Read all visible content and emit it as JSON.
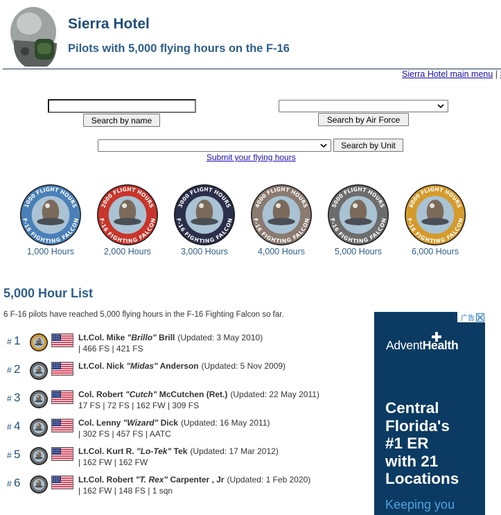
{
  "header": {
    "title": "Sierra Hotel",
    "subtitle": "Pilots with 5,000 flying hours on the F-16",
    "nav_link": "Sierra Hotel main menu",
    "nav_sep": " | ",
    "nav_next": "S"
  },
  "search": {
    "name_value": "",
    "name_button": "Search by name",
    "airforce_selected": "",
    "airforce_button": "Search by Air Force",
    "unit_selected": "",
    "unit_button": "Search by Unit",
    "submit_link": "Submit your flying hours"
  },
  "badges": [
    {
      "label": "1,000 Hours",
      "ring_text": "1000 FLIGHT HOURS",
      "ring_color": "#4a80b8"
    },
    {
      "label": "2,000 Hours",
      "ring_text": "2000 FLIGHT HOURS",
      "ring_color": "#c8352b"
    },
    {
      "label": "3,000 Hours",
      "ring_text": "3000 FLIGHT HOURS",
      "ring_color": "#2b2f4a"
    },
    {
      "label": "4,000 Hours",
      "ring_text": "4000 FLIGHT HOURS",
      "ring_color": "#8a7a70"
    },
    {
      "label": "5,000 Hours",
      "ring_text": "5000 FLIGHT HOURS",
      "ring_color": "#6c6c6c"
    },
    {
      "label": "6,000 Hours",
      "ring_text": "6000 FLIGHT HOURS",
      "ring_color": "#d59a2c"
    }
  ],
  "badge_bottom_text": "F-16 FIGHTING FALCON",
  "list": {
    "heading": "5,000 Hour List",
    "intro": "6 F-16 pilots have reached 5,000 flying hours in the F-16 Fighting Falcon so far.",
    "pilots": [
      {
        "rank_prefix": "# ",
        "rank": "1",
        "rank_name": "Lt.Col. Mike ",
        "nickname": "\"Brillo\"",
        "surname": " Brill",
        "updated": "(Updated: 3 May 2010)",
        "units": "| 466 FS | 421 FS"
      },
      {
        "rank_prefix": "# ",
        "rank": "2",
        "rank_name": "Lt.Col. Nick ",
        "nickname": "\"Midas\"",
        "surname": " Anderson",
        "updated": "(Updated: 5 Nov 2009)",
        "units": ""
      },
      {
        "rank_prefix": "# ",
        "rank": "3",
        "rank_name": "Col. Robert ",
        "nickname": "\"Cutch\"",
        "surname": " McCutchen (Ret.)",
        "updated": "(Updated: 22 May 2011)",
        "units": "17 FS | 72 FS | 162 FW | 309 FS"
      },
      {
        "rank_prefix": "# ",
        "rank": "4",
        "rank_name": "Col. Lenny ",
        "nickname": "\"Wizard\"",
        "surname": " Dick",
        "updated": "(Updated: 16 May 2011)",
        "units": "| 302 FS | 457 FS | AATC"
      },
      {
        "rank_prefix": "# ",
        "rank": "5",
        "rank_name": "Lt.Col. Kurt R. ",
        "nickname": "\"Lo-Tek\"",
        "surname": " Tek",
        "updated": "(Updated: 17 Mar 2012)",
        "units": "| 162 FW | 162 FW"
      },
      {
        "rank_prefix": "# ",
        "rank": "6",
        "rank_name": "Lt.Col. Robert ",
        "nickname": "\"T. Rex\"",
        "surname": " Carpenter , Jr",
        "updated": "(Updated: 1 Feb 2020)",
        "units": "| 162 FW | 148 FS | 1 sqn"
      }
    ]
  },
  "ad": {
    "adchoices_label": "广告",
    "logo_light": "Advent",
    "logo_bold": "Health",
    "headline_lines": [
      "Central",
      "Florida's",
      "#1 ER",
      "with 21",
      "Locations"
    ],
    "cta": "Keeping you",
    "background_color": "#0b3b62"
  },
  "icons": {
    "helmet": "pilot-helmet-icon",
    "flag": "us-flag-icon",
    "chevron": "chevron-down-icon",
    "close": "close-icon"
  }
}
